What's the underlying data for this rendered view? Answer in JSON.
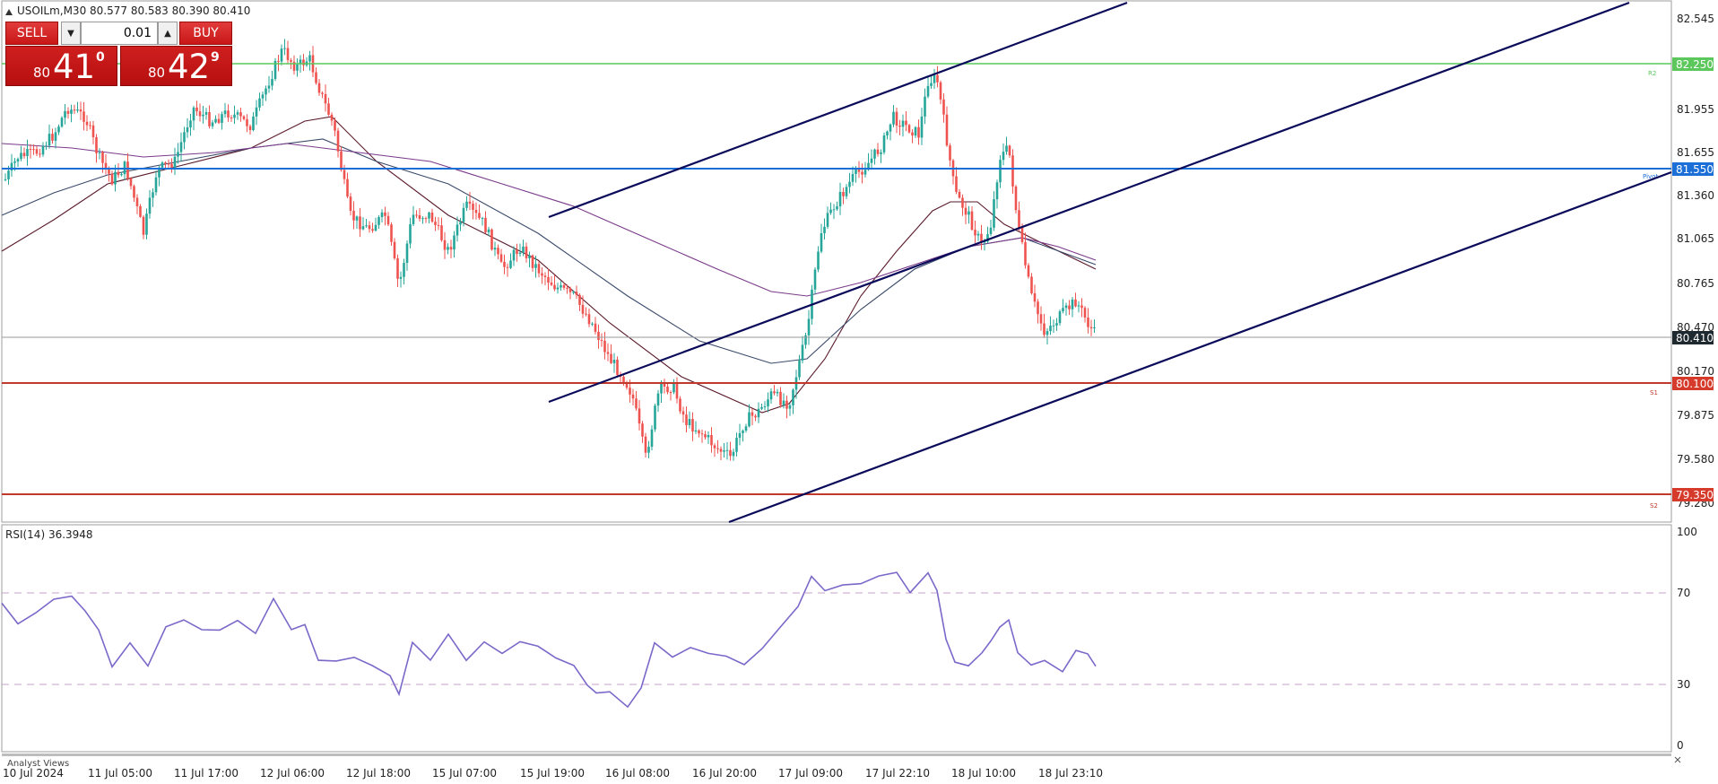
{
  "chart_header": {
    "symbol_info": "USOILm,M30  80.577 80.583 80.390 80.410"
  },
  "trade_panel": {
    "sell_label": "SELL",
    "buy_label": "BUY",
    "lot_value": "0.01",
    "sell_price_prefix": "80",
    "sell_price_big": "41",
    "sell_price_sup": "0",
    "buy_price_prefix": "80",
    "buy_price_big": "42",
    "buy_price_sup": "9",
    "spin_down_icon": "caret-down-icon",
    "spin_up_icon": "caret-up-icon"
  },
  "price_axis": {
    "ticks": [
      "82.545",
      "81.955",
      "81.655",
      "81.360",
      "81.065",
      "80.765",
      "80.470",
      "80.170",
      "79.875",
      "79.580",
      "79.280"
    ]
  },
  "price_labels": {
    "resistance2": "82.250",
    "resistance1": "81.550",
    "current": "80.410",
    "support1": "80.100",
    "support2": "79.350"
  },
  "level_tags": {
    "r2": "R2",
    "pivot": "Pivot",
    "s1": "S1",
    "s2": "S2"
  },
  "rsi": {
    "label": "RSI(14) 36.3948",
    "ticks": [
      "100",
      "70",
      "30",
      "0"
    ]
  },
  "time_axis": {
    "labels": [
      "10 Jul 2024",
      "11 Jul 05:00",
      "11 Jul 17:00",
      "12 Jul 06:00",
      "12 Jul 18:00",
      "15 Jul 07:00",
      "15 Jul 19:00",
      "16 Jul 08:00",
      "16 Jul 20:00",
      "17 Jul 09:00",
      "17 Jul 22:10",
      "18 Jul 10:00",
      "18 Jul 23:10"
    ]
  },
  "bottom_tab": "Analyst Views",
  "colors": {
    "bull": "#26a69a",
    "bear": "#ef5350",
    "resistance_green": "#5cc85c",
    "pivot_blue": "#1b6fd6",
    "support_red": "#c0392b",
    "channel": "#0a0a5a",
    "rsi_line": "#7b68c9",
    "ma_dark": "#5a1a2a",
    "ma_mid": "#3a4a6a",
    "ma_purple": "#7a3a8a"
  }
}
